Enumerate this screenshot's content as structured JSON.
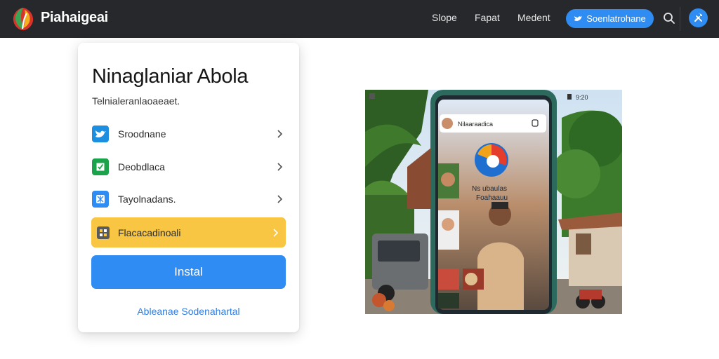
{
  "header": {
    "brand": "Piahaigeai",
    "nav": [
      "Slope",
      "Fapat",
      "Medent"
    ],
    "cta_label": "Soenlatrohane"
  },
  "card": {
    "title": "Ninaglaniar Abola",
    "subtitle": "Telnialeranlaoaeaet.",
    "options": [
      {
        "label": "Sroodnane",
        "icon": "bird-icon",
        "color": "#1d8fe0"
      },
      {
        "label": "Deobdlaca",
        "icon": "check-box-icon",
        "color": "#1aa34a"
      },
      {
        "label": "Tayolnadans.",
        "icon": "globe-icon",
        "color": "#2f8cf2"
      },
      {
        "label": "Flacacadinoali",
        "icon": "grid-icon",
        "color": "#f8c642"
      }
    ],
    "install_label": "Instal",
    "alt_link": "Ableanae Sodenahartal"
  },
  "hero": {
    "phone_app_label": "Nilaaraadica",
    "phone_caption_1": "Ns ubaulas",
    "phone_caption_2": "Foahaauu",
    "status_time": "9:20"
  },
  "colors": {
    "topbar": "#26282b",
    "accent": "#2f8cf2",
    "highlight": "#f8c642"
  }
}
